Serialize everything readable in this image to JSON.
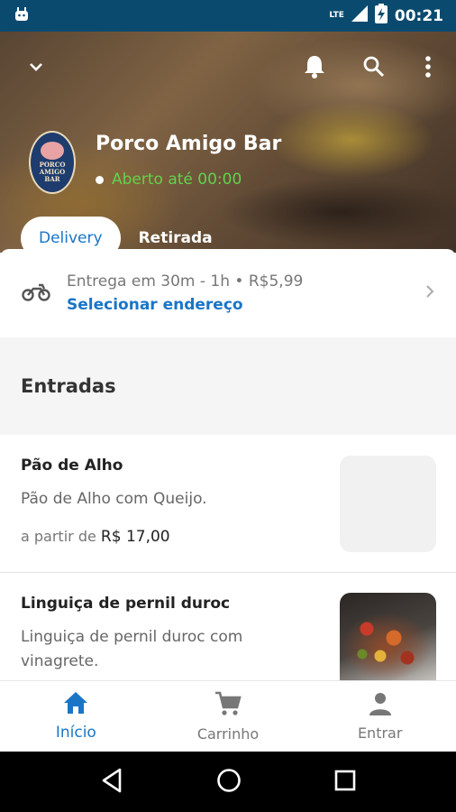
{
  "status_bar": {
    "time": "00:21",
    "network": "LTE",
    "icons": [
      "android-icon",
      "signal-icon",
      "battery-charging-icon"
    ]
  },
  "header": {
    "icons": [
      "chevron-down-icon",
      "bell-icon",
      "search-icon",
      "more-vert-icon"
    ]
  },
  "restaurant": {
    "name": "Porco Amigo Bar",
    "open_status": "Aberto até 00:00",
    "logo_text": "PORCO AMIGO BAR"
  },
  "mode_tabs": {
    "delivery": "Delivery",
    "pickup": "Retirada",
    "active": "delivery"
  },
  "delivery": {
    "info": "Entrega em 30m - 1h • R$5,99",
    "select_address": "Selecionar endereço",
    "icon": "motorcycle-icon"
  },
  "menu": {
    "section_title": "Entradas",
    "items": [
      {
        "name": "Pão de Alho",
        "description": "Pão de Alho com Queijo.",
        "price_prefix": "a partir de",
        "price": "R$ 17,00"
      },
      {
        "name": "Linguiça de pernil duroc",
        "description": "Linguiça de pernil duroc com vinagrete."
      }
    ]
  },
  "bottom_nav": {
    "items": [
      {
        "label": "Início",
        "icon": "home-icon",
        "active": true
      },
      {
        "label": "Carrinho",
        "icon": "cart-icon",
        "active": false
      },
      {
        "label": "Entrar",
        "icon": "user-icon",
        "active": false
      }
    ]
  },
  "colors": {
    "accent": "#1a75c7",
    "open_green": "#62d34c",
    "status_bar": "#0a4a6e"
  }
}
